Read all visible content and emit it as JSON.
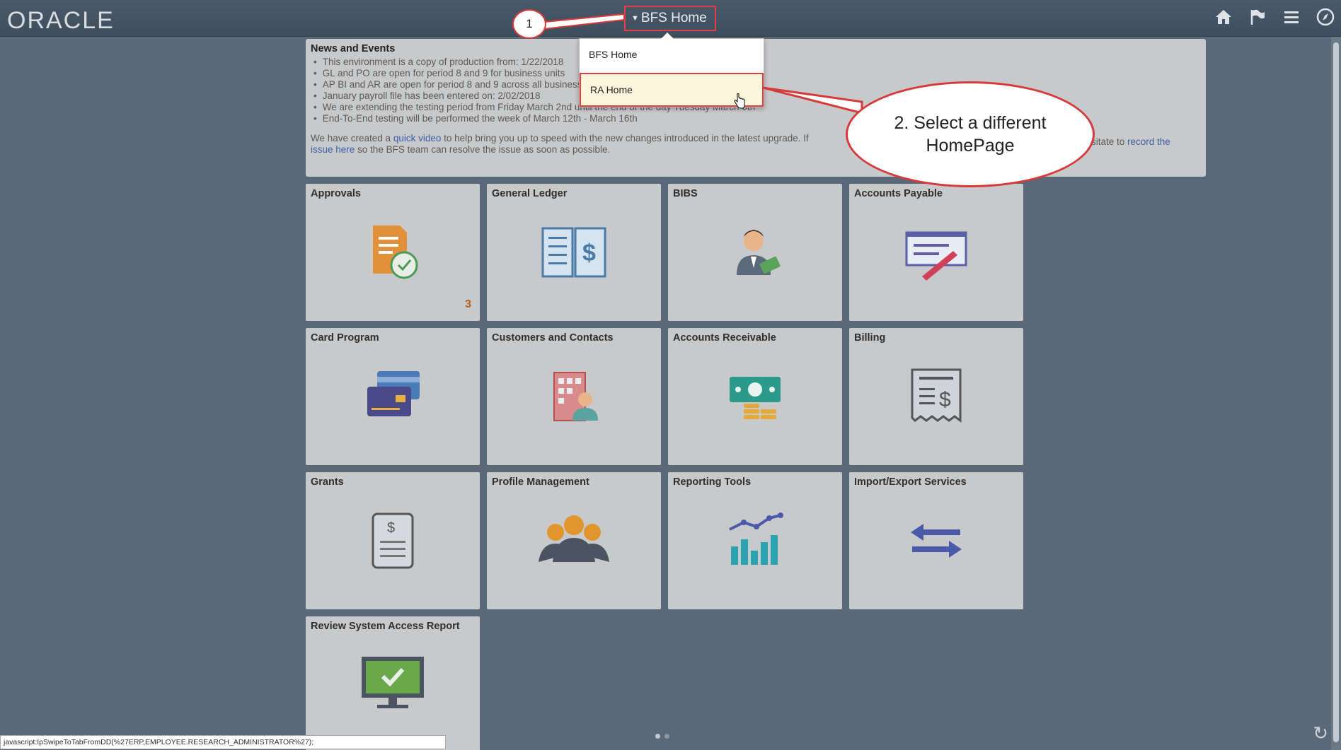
{
  "header": {
    "logo": "ORACLE",
    "homepage_selector": "BFS Home",
    "icons": [
      "home-icon",
      "flag-icon",
      "menu-icon",
      "navbar-icon"
    ]
  },
  "homepage_menu": {
    "items": [
      {
        "label": "BFS Home",
        "selected": false
      },
      {
        "label": "RA Home",
        "selected": true
      }
    ]
  },
  "callouts": {
    "step1": "1",
    "step2": "2. Select a different HomePage"
  },
  "news": {
    "title": "News and Events",
    "bullets": [
      "This environment is a copy of production from: 1/22/2018",
      "GL and PO are open for period 8 and 9 for business units",
      "AP BI and AR are open for period 8 and 9 across all business units",
      "January payroll file has been entered on: 2/02/2018",
      "We are extending the testing period from Friday March 2nd until the end of the day Tuesday March 6th",
      "End-To-End testing will be performed the week of March 12th - March 16th"
    ],
    "para_text_1": "We have created a ",
    "para_link_1": "quick video",
    "para_text_2": " to help bring you up to speed with the new changes introduced in the latest upgrade. If",
    "para_text_3": "sitate to ",
    "para_link_2": "record the",
    "para_link_3": "issue here",
    "para_text_4": " so the BFS team can resolve the issue as soon as possible."
  },
  "tiles": [
    {
      "title": "Approvals",
      "icon": "approvals-icon",
      "count": "3"
    },
    {
      "title": "General Ledger",
      "icon": "ledger-book-icon"
    },
    {
      "title": "BIBS",
      "icon": "person-money-icon"
    },
    {
      "title": "Accounts Payable",
      "icon": "check-pen-icon"
    },
    {
      "title": "Card Program",
      "icon": "credit-card-icon"
    },
    {
      "title": "Customers and Contacts",
      "icon": "building-people-icon"
    },
    {
      "title": "Accounts Receivable",
      "icon": "cash-coins-icon"
    },
    {
      "title": "Billing",
      "icon": "invoice-icon"
    },
    {
      "title": "Grants",
      "icon": "grant-document-icon"
    },
    {
      "title": "Profile Management",
      "icon": "group-people-icon"
    },
    {
      "title": "Reporting Tools",
      "icon": "bar-chart-icon"
    },
    {
      "title": "Import/Export Services",
      "icon": "arrows-exchange-icon"
    },
    {
      "title": "Review System Access Report",
      "icon": "monitor-check-icon"
    }
  ],
  "status_bar": "javascript:IpSwipeToTabFromDD(%27ERP,EMPLOYEE.RESEARCH_ADMINISTRATOR%27);",
  "colors": {
    "header": "#4a5a6a",
    "tile": "#c8c9ca",
    "highlight": "#e04040"
  }
}
